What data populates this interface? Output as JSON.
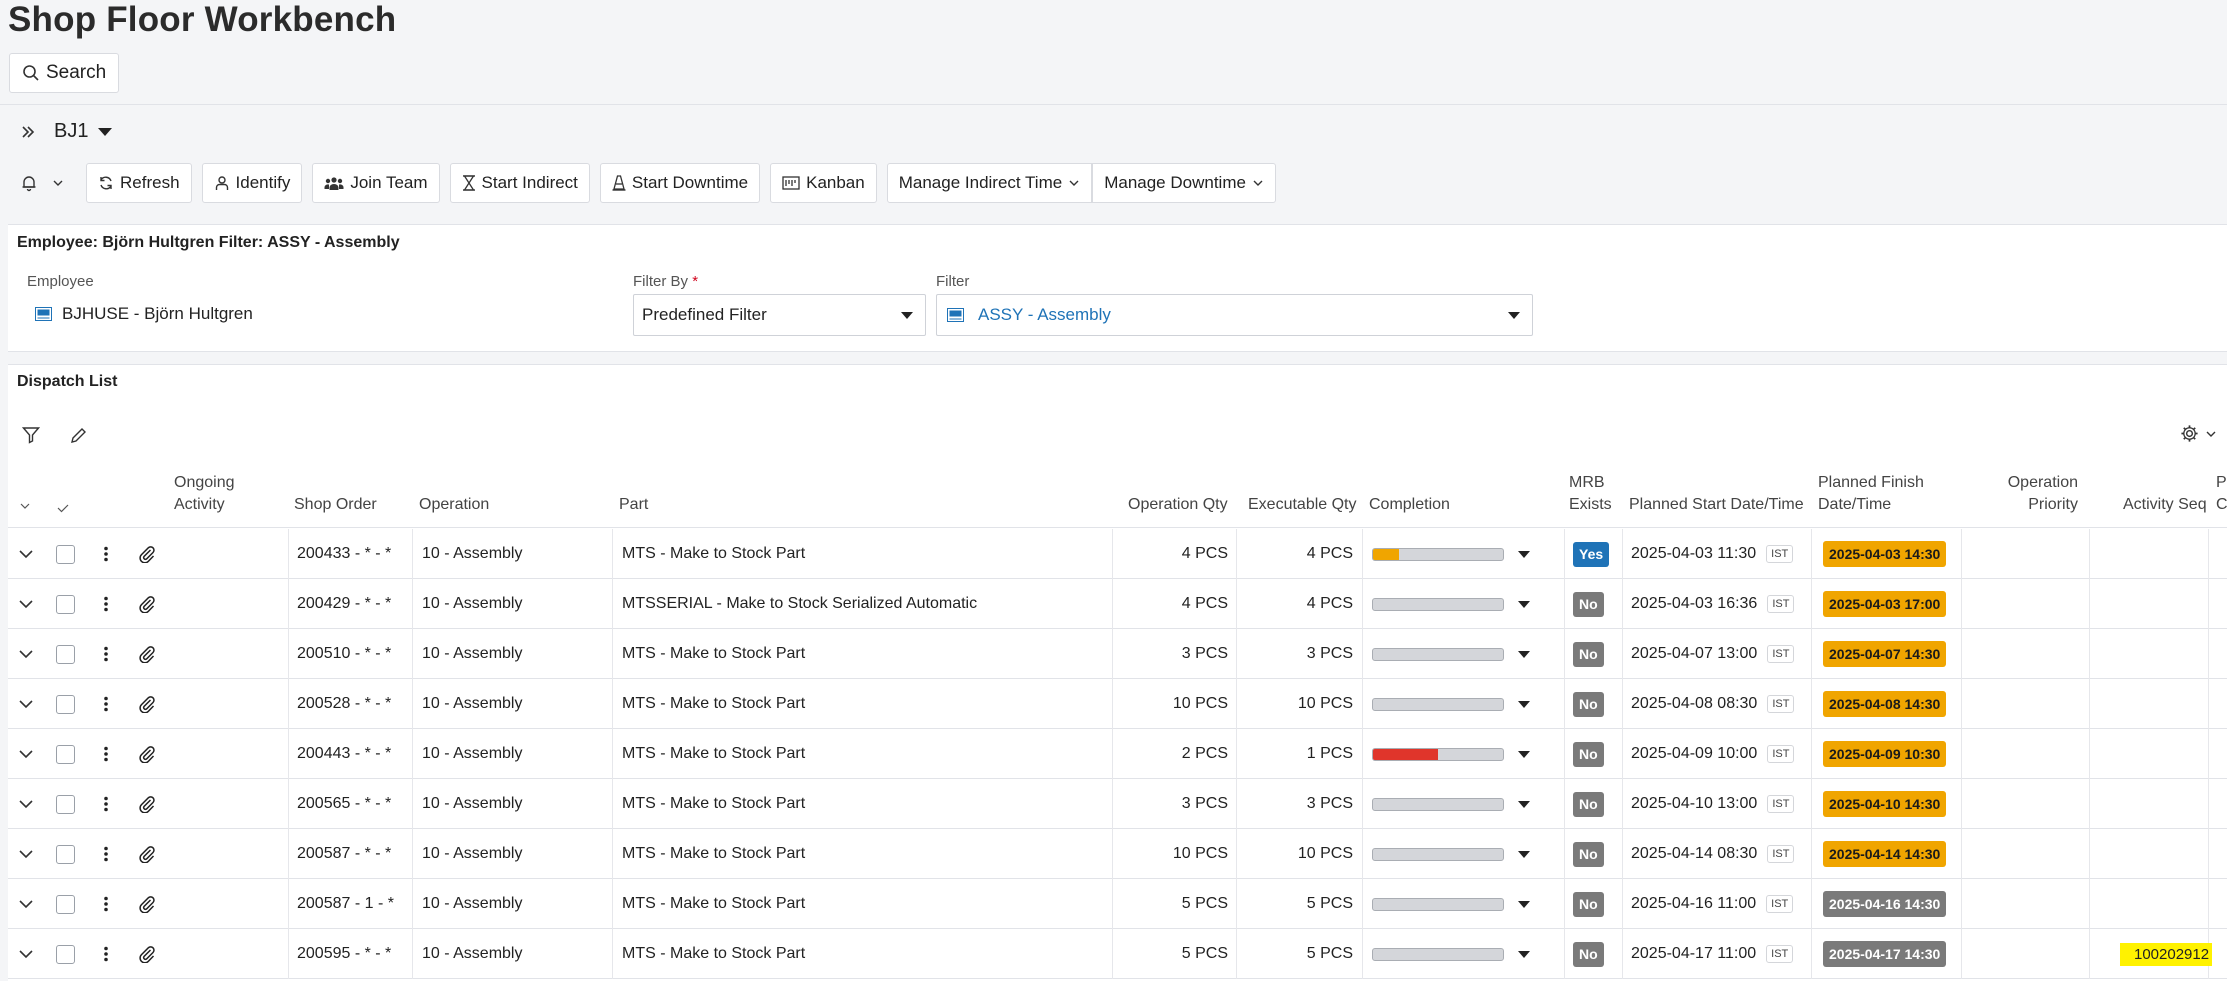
{
  "page": {
    "title": "Shop Floor Workbench",
    "search_label": "Search"
  },
  "context": {
    "site": "BJ1"
  },
  "toolbar": {
    "refresh": "Refresh",
    "identify": "Identify",
    "join_team": "Join Team",
    "start_indirect": "Start Indirect",
    "start_downtime": "Start Downtime",
    "kanban": "Kanban",
    "manage_indirect": "Manage Indirect Time",
    "manage_downtime": "Manage Downtime"
  },
  "employee_panel": {
    "title": "Employee: Björn Hultgren Filter: ASSY - Assembly",
    "employee_label": "Employee",
    "employee_value": "BJHUSE - Björn Hultgren",
    "filter_by_label": "Filter By",
    "filter_by_required": "*",
    "filter_by_value": "Predefined Filter",
    "filter_label": "Filter",
    "filter_value": "ASSY - Assembly"
  },
  "dispatch": {
    "title": "Dispatch List",
    "columns": {
      "ongoing_1": "Ongoing",
      "ongoing_2": "Activity",
      "shop_order": "Shop Order",
      "operation": "Operation",
      "part": "Part",
      "operation_qty": "Operation Qty",
      "executable_qty": "Executable Qty",
      "completion": "Completion",
      "mrb_1": "MRB",
      "mrb_2": "Exists",
      "planned_start": "Planned Start Date/Time",
      "planned_finish_1": "Planned Finish",
      "planned_finish_2": "Date/Time",
      "op_priority_1": "Operation",
      "op_priority_2": "Priority",
      "activity_seq": "Activity Seq",
      "next_1": "P",
      "next_2": "C"
    },
    "rows": [
      {
        "shop_order": "200433 - * - *",
        "operation": "10 - Assembly",
        "part": "MTS - Make to Stock Part",
        "op_qty": "4 PCS",
        "exec_qty": "4 PCS",
        "completion": 0.2,
        "completion_color": "#f0a500",
        "mrb": "Yes",
        "planned_start": "2025-04-03 11:30",
        "tz": "IST",
        "planned_finish": "2025-04-03 14:30",
        "finish_status": "late",
        "activity_seq": ""
      },
      {
        "shop_order": "200429 - * - *",
        "operation": "10 - Assembly",
        "part": "MTSSERIAL - Make to Stock Serialized Automatic",
        "op_qty": "4 PCS",
        "exec_qty": "4 PCS",
        "completion": 0,
        "completion_color": "#f0a500",
        "mrb": "No",
        "planned_start": "2025-04-03 16:36",
        "tz": "IST",
        "planned_finish": "2025-04-03 17:00",
        "finish_status": "late",
        "activity_seq": ""
      },
      {
        "shop_order": "200510 - * - *",
        "operation": "10 - Assembly",
        "part": "MTS - Make to Stock Part",
        "op_qty": "3 PCS",
        "exec_qty": "3 PCS",
        "completion": 0,
        "completion_color": "#f0a500",
        "mrb": "No",
        "planned_start": "2025-04-07 13:00",
        "tz": "IST",
        "planned_finish": "2025-04-07 14:30",
        "finish_status": "late",
        "activity_seq": ""
      },
      {
        "shop_order": "200528 - * - *",
        "operation": "10 - Assembly",
        "part": "MTS - Make to Stock Part",
        "op_qty": "10 PCS",
        "exec_qty": "10 PCS",
        "completion": 0,
        "completion_color": "#f0a500",
        "mrb": "No",
        "planned_start": "2025-04-08 08:30",
        "tz": "IST",
        "planned_finish": "2025-04-08 14:30",
        "finish_status": "late",
        "activity_seq": ""
      },
      {
        "shop_order": "200443 - * - *",
        "operation": "10 - Assembly",
        "part": "MTS - Make to Stock Part",
        "op_qty": "2 PCS",
        "exec_qty": "1 PCS",
        "completion": 0.5,
        "completion_color": "#e0352b",
        "mrb": "No",
        "planned_start": "2025-04-09 10:00",
        "tz": "IST",
        "planned_finish": "2025-04-09 10:30",
        "finish_status": "late",
        "activity_seq": ""
      },
      {
        "shop_order": "200565 - * - *",
        "operation": "10 - Assembly",
        "part": "MTS - Make to Stock Part",
        "op_qty": "3 PCS",
        "exec_qty": "3 PCS",
        "completion": 0,
        "completion_color": "#f0a500",
        "mrb": "No",
        "planned_start": "2025-04-10 13:00",
        "tz": "IST",
        "planned_finish": "2025-04-10 14:30",
        "finish_status": "late",
        "activity_seq": ""
      },
      {
        "shop_order": "200587 - * - *",
        "operation": "10 - Assembly",
        "part": "MTS - Make to Stock Part",
        "op_qty": "10 PCS",
        "exec_qty": "10 PCS",
        "completion": 0,
        "completion_color": "#f0a500",
        "mrb": "No",
        "planned_start": "2025-04-14 08:30",
        "tz": "IST",
        "planned_finish": "2025-04-14 14:30",
        "finish_status": "late",
        "activity_seq": ""
      },
      {
        "shop_order": "200587 - 1 - *",
        "operation": "10 - Assembly",
        "part": "MTS - Make to Stock Part",
        "op_qty": "5 PCS",
        "exec_qty": "5 PCS",
        "completion": 0,
        "completion_color": "#f0a500",
        "mrb": "No",
        "planned_start": "2025-04-16 11:00",
        "tz": "IST",
        "planned_finish": "2025-04-16 14:30",
        "finish_status": "future",
        "activity_seq": ""
      },
      {
        "shop_order": "200595 - * - *",
        "operation": "10 - Assembly",
        "part": "MTS - Make to Stock Part",
        "op_qty": "5 PCS",
        "exec_qty": "5 PCS",
        "completion": 0,
        "completion_color": "#f0a500",
        "mrb": "No",
        "planned_start": "2025-04-17 11:00",
        "tz": "IST",
        "planned_finish": "2025-04-17 14:30",
        "finish_status": "future",
        "activity_seq": "100202912"
      }
    ]
  },
  "colors": {
    "accent": "#1f73b7",
    "mrb_yes": "#1f73b7",
    "mrb_no": "#7a7a7a",
    "finish_late": "#f0a500",
    "finish_future": "#7a7a7a",
    "highlight": "#fff200"
  }
}
